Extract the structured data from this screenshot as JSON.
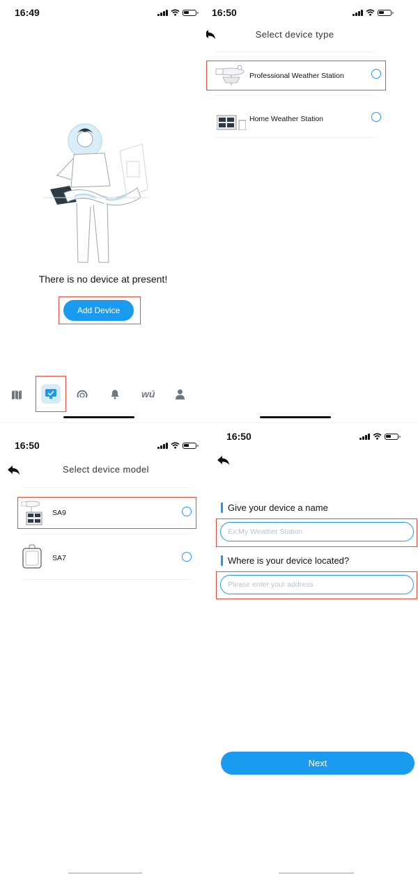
{
  "screen1": {
    "time": "16:49",
    "empty_message": "There is no device at present!",
    "add_device_label": "Add Device",
    "tabbar": {
      "items": [
        "map-icon",
        "device-icon",
        "dashboard-icon",
        "bell-icon",
        "wu-logo-icon",
        "profile-icon"
      ],
      "wu_text": "wú",
      "active": "device-icon"
    },
    "colors": {
      "accent": "#1a9bf0",
      "highlight": "#e84b3a"
    }
  },
  "screen2": {
    "time": "16:50",
    "title": "Select device type",
    "options": [
      {
        "label": "Professional Weather Station",
        "icon": "weather-station-icon",
        "selected": false
      },
      {
        "label": "Home Weather Station",
        "icon": "console-icon",
        "selected": false
      }
    ]
  },
  "screen3": {
    "time": "16:50",
    "title": "Select device model",
    "options": [
      {
        "label": "SA9",
        "icon": "sa9-device-icon",
        "selected": false
      },
      {
        "label": "SA7",
        "icon": "sa7-device-icon",
        "selected": false
      }
    ]
  },
  "screen4": {
    "time": "16:50",
    "name_label": "Give your device a name",
    "name_placeholder": "Ex:My Weather Station",
    "name_value": "",
    "location_label": "Where is your device located?",
    "location_placeholder": "Please enter your address",
    "location_value": "",
    "next_label": "Next"
  }
}
